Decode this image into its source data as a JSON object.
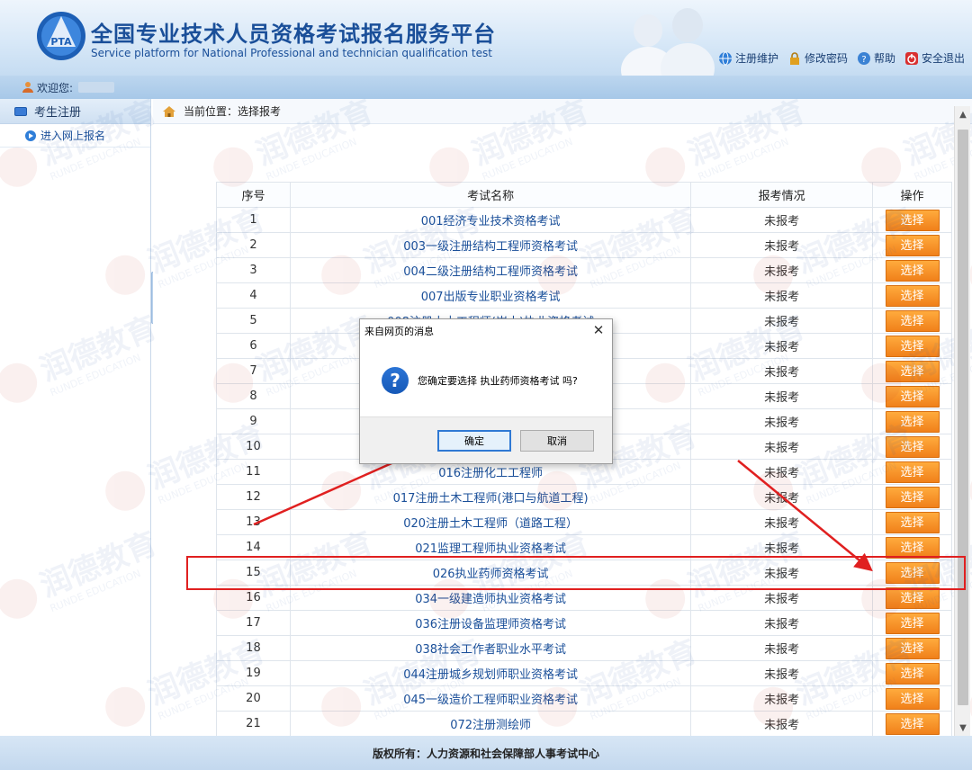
{
  "header": {
    "title_cn": "全国专业技术人员资格考试报名服务平台",
    "title_en": "Service platform for National Professional and technician qualification test",
    "logo_text": "PTA",
    "links": [
      {
        "label": "注册维护",
        "icon": "globe-icon"
      },
      {
        "label": "修改密码",
        "icon": "lock-icon"
      },
      {
        "label": "帮助",
        "icon": "help-icon"
      },
      {
        "label": "安全退出",
        "icon": "power-icon"
      }
    ]
  },
  "welcome": {
    "label": "欢迎您:"
  },
  "sidebar": {
    "section": "考生注册",
    "items": [
      {
        "label": "进入网上报名"
      }
    ]
  },
  "breadcrumb": {
    "label": "当前位置：选择报考"
  },
  "table": {
    "headers": [
      "序号",
      "考试名称",
      "报考情况",
      "操作"
    ],
    "rows": [
      {
        "no": "1",
        "name": "001经济专业技术资格考试",
        "status": "未报考",
        "action": "选择"
      },
      {
        "no": "2",
        "name": "003一级注册结构工程师资格考试",
        "status": "未报考",
        "action": "选择"
      },
      {
        "no": "3",
        "name": "004二级注册结构工程师资格考试",
        "status": "未报考",
        "action": "选择"
      },
      {
        "no": "4",
        "name": "007出版专业职业资格考试",
        "status": "未报考",
        "action": "选择"
      },
      {
        "no": "5",
        "name": "008注册土木工程师(岩土)执业资格考试",
        "status": "未报考",
        "action": "选择"
      },
      {
        "no": "6",
        "name": "",
        "status": "未报考",
        "action": "选择"
      },
      {
        "no": "7",
        "name": "",
        "status": "未报考",
        "action": "选择"
      },
      {
        "no": "8",
        "name": "",
        "status": "未报考",
        "action": "选择"
      },
      {
        "no": "9",
        "name": "",
        "status": "未报考",
        "action": "选择"
      },
      {
        "no": "10",
        "name": "",
        "status": "未报考",
        "action": "选择"
      },
      {
        "no": "11",
        "name": "016注册化工工程师",
        "status": "未报考",
        "action": "选择"
      },
      {
        "no": "12",
        "name": "017注册土木工程师(港口与航道工程)",
        "status": "未报考",
        "action": "选择"
      },
      {
        "no": "13",
        "name": "020注册土木工程师（道路工程）",
        "status": "未报考",
        "action": "选择"
      },
      {
        "no": "14",
        "name": "021监理工程师执业资格考试",
        "status": "未报考",
        "action": "选择"
      },
      {
        "no": "15",
        "name": "026执业药师资格考试",
        "status": "未报考",
        "action": "选择"
      },
      {
        "no": "16",
        "name": "034一级建造师执业资格考试",
        "status": "未报考",
        "action": "选择"
      },
      {
        "no": "17",
        "name": "036注册设备监理师资格考试",
        "status": "未报考",
        "action": "选择"
      },
      {
        "no": "18",
        "name": "038社会工作者职业水平考试",
        "status": "未报考",
        "action": "选择"
      },
      {
        "no": "19",
        "name": "044注册城乡规划师职业资格考试",
        "status": "未报考",
        "action": "选择"
      },
      {
        "no": "20",
        "name": "045一级造价工程师职业资格考试",
        "status": "未报考",
        "action": "选择"
      },
      {
        "no": "21",
        "name": "072注册测绘师",
        "status": "未报考",
        "action": "选择"
      }
    ]
  },
  "dialog": {
    "title": "来自网页的消息",
    "message": "您确定要选择 执业药师资格考试 吗?",
    "ok_label": "确定",
    "cancel_label": "取消",
    "icon": "question-icon"
  },
  "watermark": {
    "text_cn": "润德教育",
    "text_en": "RUNDE EDUCATION"
  },
  "footer": {
    "label": "版权所有：人力资源和社会保障部人事考试中心"
  },
  "colors": {
    "brand_blue": "#1a4f99",
    "select_orange": "#f0801a",
    "annotation_red": "#e02020"
  }
}
